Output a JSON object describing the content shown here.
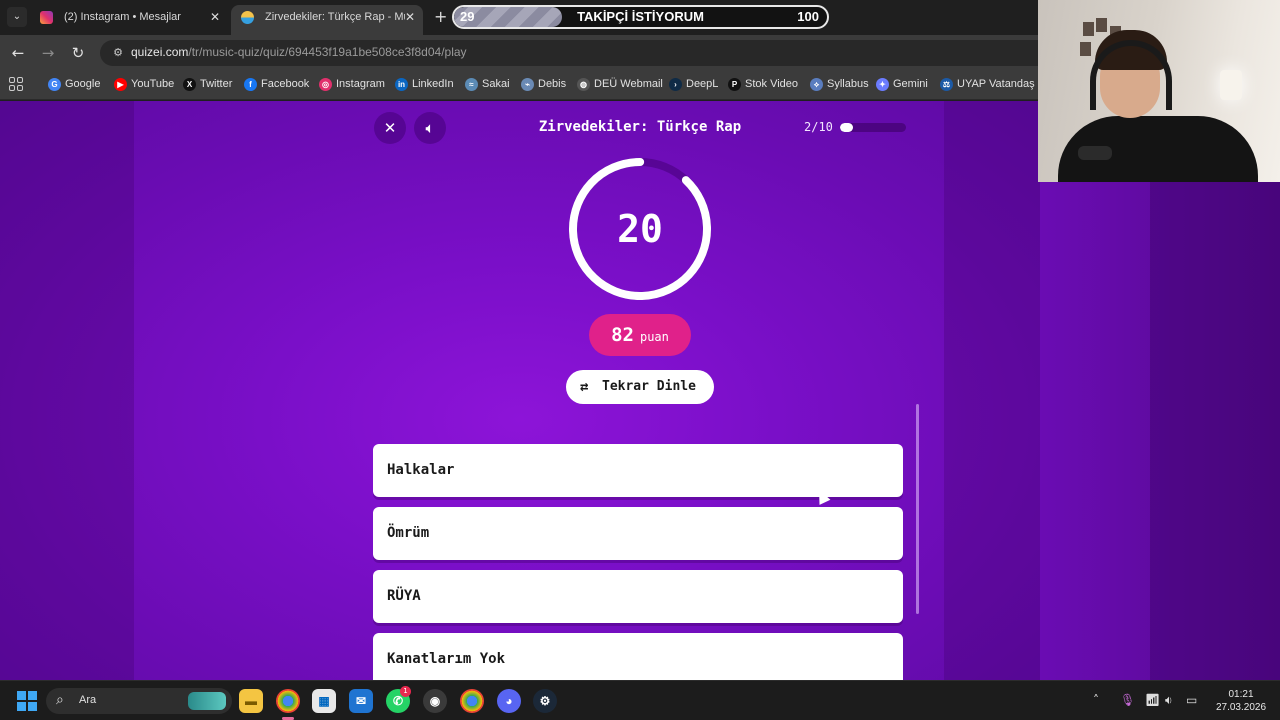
{
  "browser": {
    "tabs": [
      {
        "title": "(2) Instagram • Mesajlar",
        "active": false
      },
      {
        "title": "Zirvedekiler: Türkçe Rap - Music Quiz",
        "active": true
      }
    ],
    "url_host": "quizei.com",
    "url_path": "/tr/music-quiz/quiz/694453f19a1be508ce3f8d04/play",
    "bookmarks": [
      {
        "label": "Google",
        "icon": "G",
        "color": "#4285f4"
      },
      {
        "label": "YouTube",
        "icon": "▶",
        "color": "#ff0000"
      },
      {
        "label": "Twitter",
        "icon": "X",
        "color": "#111111"
      },
      {
        "label": "Facebook",
        "icon": "f",
        "color": "#1877f2"
      },
      {
        "label": "Instagram",
        "icon": "◎",
        "color": "#e1306c"
      },
      {
        "label": "LinkedIn",
        "icon": "in",
        "color": "#0a66c2"
      },
      {
        "label": "Sakai",
        "icon": "≈",
        "color": "#5b8bb5"
      },
      {
        "label": "Debis",
        "icon": "⌁",
        "color": "#6a8ab5"
      },
      {
        "label": "DEÜ Webmail",
        "icon": "◍",
        "color": "#555555"
      },
      {
        "label": "DeepL",
        "icon": "›",
        "color": "#0f2b46"
      },
      {
        "label": "Stok Video",
        "icon": "P",
        "color": "#111111"
      },
      {
        "label": "Syllabus",
        "icon": "⟡",
        "color": "#5a7dbf"
      },
      {
        "label": "Gemini",
        "icon": "✦",
        "color": "#6b7cff"
      },
      {
        "label": "UYAP Vatandaş",
        "icon": "⚖",
        "color": "#1c5aa6"
      }
    ]
  },
  "stream_overlay": {
    "current": "29",
    "label": "TAKİPÇİ İSTİYORUM",
    "goal": "100",
    "progress_fraction": 0.29
  },
  "quiz": {
    "title": "Zirvedekiler: Türkçe Rap",
    "progress_text": "2/10",
    "progress_fraction": 0.2,
    "timer_value": "20",
    "timer_fraction": 0.88,
    "score_value": "82",
    "score_unit": "puan",
    "replay_label": "Tekrar Dinle",
    "options": [
      "Halkalar",
      "Ömrüm",
      "RÜYA",
      "Kanatlarım Yok"
    ]
  },
  "taskbar": {
    "search_placeholder": "Ara",
    "time": "01:21",
    "date": "27.03.2026",
    "instagram_badge": "1"
  },
  "colors": {
    "page_purple": "#7a0fc8",
    "score_pink": "#e0218a",
    "windows_blue": "#3fa8f4"
  }
}
